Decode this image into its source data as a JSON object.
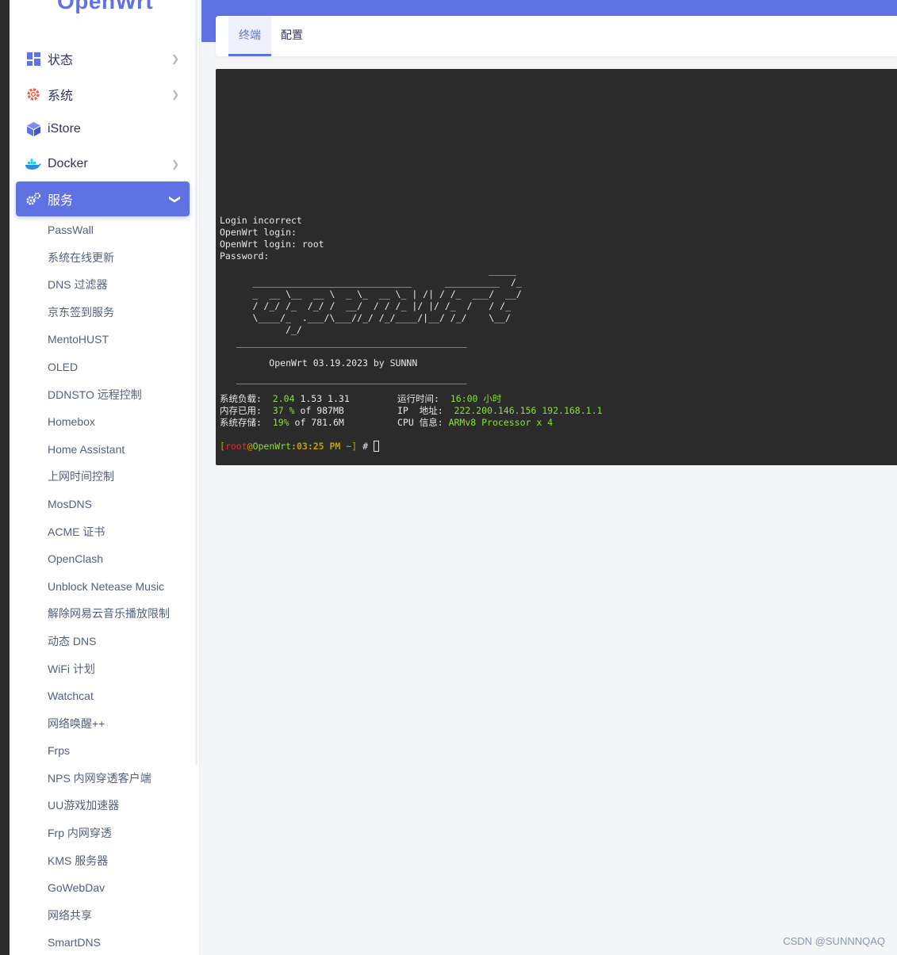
{
  "sidebar": {
    "logo": "OpenWrt",
    "menu": [
      {
        "label": "状态",
        "icon": "dashboard-icon",
        "has_chevron": true
      },
      {
        "label": "系统",
        "icon": "gear-icon",
        "has_chevron": true
      },
      {
        "label": "iStore",
        "icon": "cube-icon",
        "has_chevron": false
      },
      {
        "label": "Docker",
        "icon": "docker-whale-icon",
        "has_chevron": true
      },
      {
        "label": "服务",
        "icon": "cogs-icon",
        "has_chevron": true,
        "active": true
      }
    ],
    "submenu": [
      "PassWall",
      "系统在线更新",
      "DNS 过滤器",
      "京东签到服务",
      "MentoHUST",
      "OLED",
      "DDNSTO 远程控制",
      "Homebox",
      "Home Assistant",
      "上网时间控制",
      "MosDNS",
      "ACME 证书",
      "OpenClash",
      "Unblock Netease Music",
      "解除网易云音乐播放限制",
      "动态 DNS",
      "WiFi 计划",
      "Watchcat",
      "网络唤醒++",
      "Frps",
      "NPS 内网穿透客户端",
      "UU游戏加速器",
      "Frp 内网穿透",
      "KMS 服务器",
      "GoWebDav",
      "网络共享",
      "SmartDNS"
    ]
  },
  "tabs": [
    {
      "label": "终端",
      "active": true
    },
    {
      "label": "配置",
      "active": false
    }
  ],
  "terminal": {
    "login_lines": [
      "Login incorrect",
      "OpenWrt login:",
      "OpenWrt login: root",
      "Password:"
    ],
    "ascii_art": [
      "                                                 _____",
      "      _____________________________      __________  /_",
      "      _  __ \\__  __ \\  _ \\_  __ \\_ | /| / /_  ___/  __/",
      "      / /_/ /_  /_/ /  __/  / / /_ |/ |/ /_  /   / /_",
      "      \\____/_  .___/\\___//_/ /_/____/|__/ /_/    \\__/",
      "            /_/"
    ],
    "separator": "   __________________________________________",
    "version_line": "         OpenWrt 03.19.2023 by SUNNN",
    "stats": {
      "load_label": "系统负载:",
      "load_highlight": "2.04",
      "load_rest": "1.53 1.31",
      "uptime_label": "运行时间:",
      "uptime_value": "16:00 小时",
      "mem_label": "内存已用:",
      "mem_highlight": "37 %",
      "mem_rest": "of 987MB",
      "ip_label": "IP  地址:",
      "ip_value": "222.200.146.156 192.168.1.1",
      "disk_label": "系统存储:",
      "disk_highlight": "19%",
      "disk_rest": "of 781.6M",
      "cpu_label": "CPU 信息:",
      "cpu_value": "ARMv8 Processor x 4"
    },
    "prompt": {
      "user": "root",
      "at": "@",
      "host": "OpenWrt",
      "time": ":03:25 PM",
      "path": "~",
      "symbol": "#"
    }
  },
  "watermark": "CSDN @SUNNNQAQ",
  "colors": {
    "accent": "#5e72e4",
    "terminal_bg": "#2b2b2b",
    "terminal_green": "#8ae234",
    "terminal_red": "#ef2929"
  }
}
